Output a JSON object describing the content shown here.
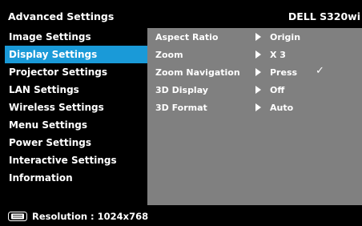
{
  "header": {
    "title": "Advanced Settings",
    "model": "DELL S320wi"
  },
  "menu": {
    "items": [
      {
        "label": "Image Settings",
        "selected": false
      },
      {
        "label": "Display Settings",
        "selected": true
      },
      {
        "label": "Projector Settings",
        "selected": false
      },
      {
        "label": "LAN Settings",
        "selected": false
      },
      {
        "label": "Wireless Settings",
        "selected": false
      },
      {
        "label": "Menu Settings",
        "selected": false
      },
      {
        "label": "Power Settings",
        "selected": false
      },
      {
        "label": "Interactive Settings",
        "selected": false
      },
      {
        "label": "Information",
        "selected": false
      }
    ]
  },
  "panel": {
    "rows": [
      {
        "label": "Aspect Ratio",
        "value": "Origin",
        "check": ""
      },
      {
        "label": "Zoom",
        "value": "X 3",
        "check": ""
      },
      {
        "label": "Zoom Navigation",
        "value": "Press",
        "check": "✓"
      },
      {
        "label": "3D Display",
        "value": "Off",
        "check": ""
      },
      {
        "label": "3D Format",
        "value": "Auto",
        "check": ""
      }
    ]
  },
  "footer": {
    "resolution": "Resolution : 1024x768",
    "icon": "monitor-icon"
  },
  "colors": {
    "selected": "#1a9ad8",
    "panel": "#808080",
    "background": "#000000"
  }
}
